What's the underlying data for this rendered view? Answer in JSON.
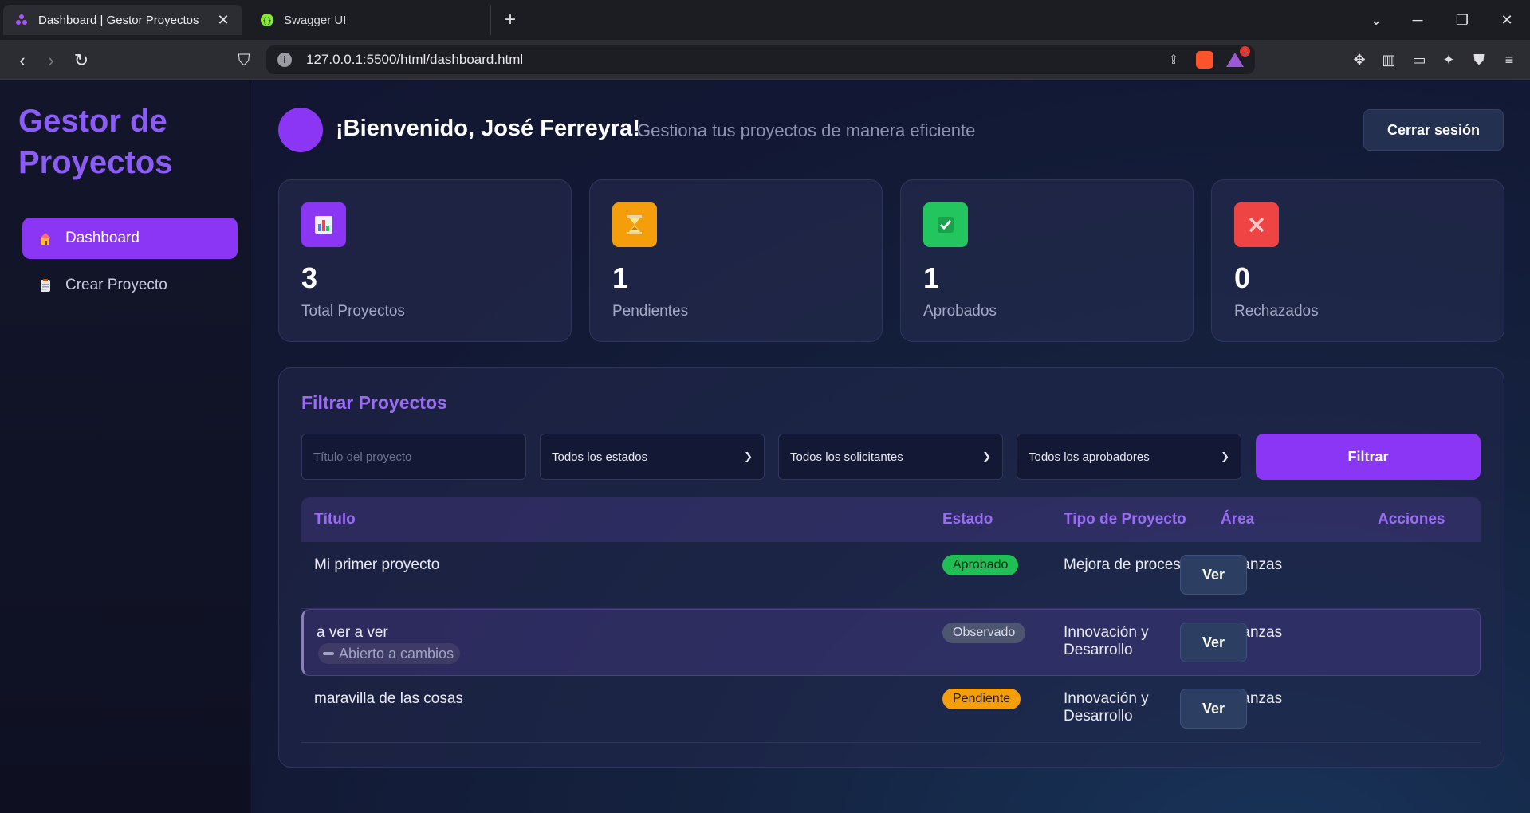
{
  "browser": {
    "tabs": [
      {
        "title": "Dashboard | Gestor Proyectos",
        "active": true
      },
      {
        "title": "Swagger UI",
        "active": false
      }
    ],
    "url": "127.0.0.1:5500/html/dashboard.html",
    "notification_count": "1"
  },
  "sidebar": {
    "brand": "Gestor de Proyectos",
    "items": [
      {
        "label": "Dashboard",
        "icon": "house-icon",
        "active": true
      },
      {
        "label": "Crear Proyecto",
        "icon": "clipboard-icon",
        "active": false
      }
    ]
  },
  "header": {
    "welcome": "¡Bienvenido, José Ferreyra!",
    "subtitle": "Gestiona tus proyectos de manera eficiente",
    "logout_label": "Cerrar sesión"
  },
  "stats": [
    {
      "value": "3",
      "label": "Total Proyectos",
      "icon": "bar-chart-icon",
      "color": "#8b35f5"
    },
    {
      "value": "1",
      "label": "Pendientes",
      "icon": "hourglass-icon",
      "color": "#f59e0b"
    },
    {
      "value": "1",
      "label": "Aprobados",
      "icon": "check-icon",
      "color": "#22c55e"
    },
    {
      "value": "0",
      "label": "Rechazados",
      "icon": "cross-icon",
      "color": "#ef4444"
    }
  ],
  "filters": {
    "title": "Filtrar Proyectos",
    "title_placeholder": "Título del proyecto",
    "estado_selected": "Todos los estados",
    "solicitante_selected": "Todos los solicitantes",
    "aprobador_selected": "Todos los aprobadores",
    "button_label": "Filtrar"
  },
  "table": {
    "headers": [
      "Título",
      "Estado",
      "Tipo de Proyecto",
      "Área",
      "Acciones"
    ],
    "rows": [
      {
        "title": "Mi primer proyecto",
        "status": "Aprobado",
        "type": "Mejora de procesos",
        "area": "Finanzas",
        "action": "Ver"
      },
      {
        "title": "a ver a ver",
        "subtag": "Abierto a cambios",
        "status": "Observado",
        "type": "Innovación y Desarrollo",
        "area": "Finanzas",
        "action": "Ver"
      },
      {
        "title": "maravilla de las cosas",
        "status": "Pendiente",
        "type": "Innovación y Desarrollo",
        "area": "Finanzas",
        "action": "Ver"
      }
    ]
  },
  "colors": {
    "accent": "#8b35f5",
    "approved": "#1fbf55",
    "observed": "#4d5671",
    "pending": "#f59e0b"
  }
}
